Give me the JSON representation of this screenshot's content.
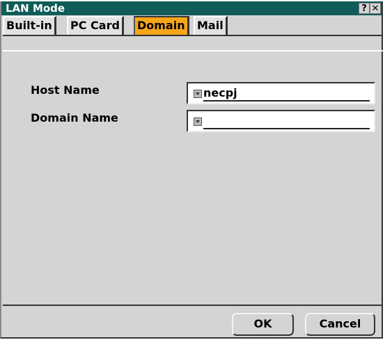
{
  "window": {
    "title": "LAN Mode",
    "help_icon_label": "?",
    "close_icon": "close-icon"
  },
  "tabs": [
    {
      "label": "Built-in",
      "active": false
    },
    {
      "label": "PC Card",
      "active": false
    },
    {
      "label": "Domain",
      "active": true
    },
    {
      "label": "Mail",
      "active": false
    }
  ],
  "fields": {
    "host": {
      "label": "Host Name",
      "value": "necpj"
    },
    "domain": {
      "label": "Domain Name",
      "value": ""
    }
  },
  "buttons": {
    "ok": "OK",
    "cancel": "Cancel"
  },
  "colors": {
    "titlebar": "#0f5c59",
    "active_tab": "#f5a61b",
    "window_bg": "#d4d4d4"
  }
}
